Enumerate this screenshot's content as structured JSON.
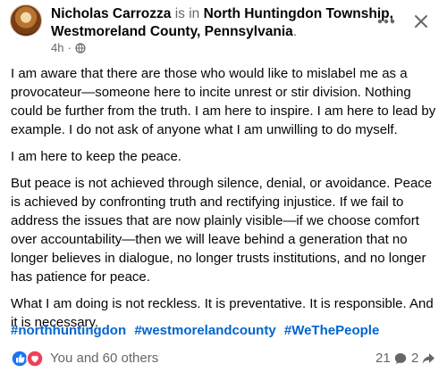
{
  "post": {
    "author": "Nicholas Carrozza",
    "is_in": "is in",
    "location_line1": "North Huntingdon Township,",
    "location_line2": "Westmoreland County, Pennsylvania",
    "location_period": ".",
    "time": "4h",
    "separator": "·",
    "audience_icon": "globe-icon",
    "paragraphs": [
      "I am aware that there are those who would like to mislabel me as a provocateur—someone here to incite unrest or stir division. Nothing could be further from the truth. I am here to inspire. I am here to lead by example. I do not ask of anyone what I am unwilling to do myself.",
      "I am here to keep the peace.",
      "But peace is not achieved through silence, denial, or avoidance. Peace is achieved by confronting truth and rectifying injustice. If we fail to address the issues that are now plainly visible—if we choose comfort over accountability—then we will leave behind a generation that no longer believes in dialogue, no longer trusts institutions, and no longer has patience for peace.",
      "What I am doing is not reckless. It is preventative. It is responsible. And it is necessary."
    ],
    "hashtags": [
      "#northhuntingdon",
      "#westmorelandcounty",
      "#WeThePeople"
    ]
  },
  "footer": {
    "reactions_text": "You and 60 others",
    "comment_count": "21",
    "share_count": "2",
    "reaction_icons": [
      "like-icon",
      "love-icon"
    ]
  },
  "colors": {
    "link_blue": "#0064d1",
    "muted_gray": "#65676b",
    "like_blue": "#1877f2",
    "love_red": "#f33e58"
  }
}
